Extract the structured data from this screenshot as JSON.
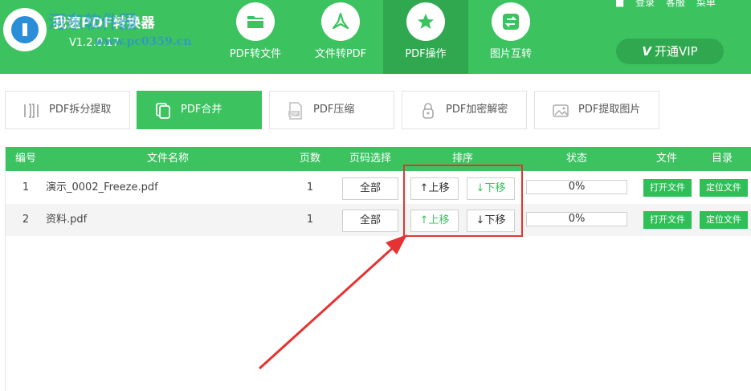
{
  "header": {
    "app_title": "我速PDF转换器",
    "version": "V1.2.0.17",
    "watermark": "河东软件园",
    "watermark_url": "www.pc0359.cn",
    "nav": [
      {
        "label": "PDF转文件",
        "icon": "folder-icon"
      },
      {
        "label": "文件转PDF",
        "icon": "acrobat-icon"
      },
      {
        "label": "PDF操作",
        "icon": "star-icon"
      },
      {
        "label": "图片互转",
        "icon": "swap-icon"
      }
    ],
    "active_nav": "PDF操作",
    "top_links": [
      "登录",
      "客服",
      "菜单"
    ],
    "vip_label": "开通VIP",
    "vip_logo": "V",
    "colors": {
      "brand": "#3cc360",
      "brand_dark": "#2fa84f"
    }
  },
  "tools": [
    {
      "label": "PDF拆分提取",
      "icon": "split-icon"
    },
    {
      "label": "PDF合并",
      "icon": "merge-icon"
    },
    {
      "label": "PDF压缩",
      "icon": "zip-icon"
    },
    {
      "label": "PDF加密解密",
      "icon": "lock-icon"
    },
    {
      "label": "PDF提取图片",
      "icon": "image-icon"
    }
  ],
  "active_tool": "PDF合并",
  "table": {
    "columns": [
      "编号",
      "文件名称",
      "页数",
      "页码选择",
      "排序",
      "状态",
      "文件",
      "目录"
    ],
    "rows": [
      {
        "index": "1",
        "name": "演示_0002_Freeze.pdf",
        "pages": "1",
        "page_select": "全部",
        "up": "↑上移",
        "down": "↓下移",
        "status": "0%",
        "progress": 0,
        "open": "打开文件",
        "locate": "定位文件"
      },
      {
        "index": "2",
        "name": "资料.pdf",
        "pages": "1",
        "page_select": "全部",
        "up": "↑上移",
        "down": "↓下移",
        "status": "0%",
        "progress": 0,
        "open": "打开文件",
        "locate": "定位文件"
      }
    ]
  },
  "annotation": {
    "color": "#e53333"
  }
}
